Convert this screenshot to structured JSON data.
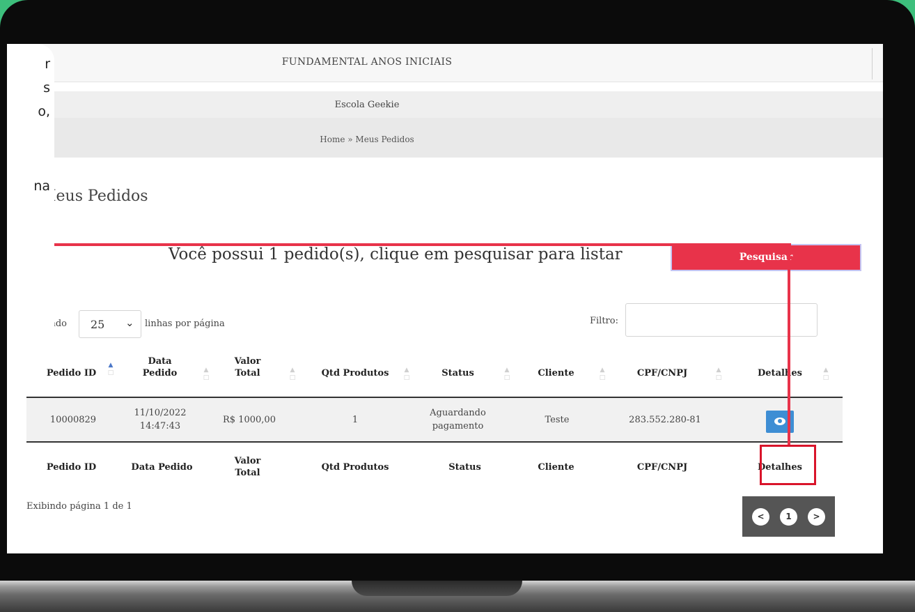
{
  "header": {
    "title": "FUNDAMENTAL ANOS INICIAIS",
    "school": "Escola Geekie",
    "breadcrumb": "Home » Meus Pedidos"
  },
  "sidebar": {
    "fragments": [
      "r",
      "s",
      "o,",
      "na"
    ]
  },
  "page": {
    "heading": "Meus Pedidos",
    "notice": "Você possui 1 pedido(s), clique em pesquisar para listar",
    "search_button": "Pesquisar"
  },
  "table_controls": {
    "show_label": "Exibindo",
    "rows_value": "25",
    "per_page_label": "linhas por página",
    "filter_label": "Filtro:",
    "filter_value": ""
  },
  "table": {
    "headers": [
      {
        "l1": "Pedido ID",
        "l2": ""
      },
      {
        "l1": "Data",
        "l2": "Pedido"
      },
      {
        "l1": "Valor",
        "l2": "Total"
      },
      {
        "l1": "Qtd Produtos",
        "l2": ""
      },
      {
        "l1": "Status",
        "l2": ""
      },
      {
        "l1": "Cliente",
        "l2": ""
      },
      {
        "l1": "CPF/CNPJ",
        "l2": ""
      },
      {
        "l1": "Detalhes",
        "l2": ""
      }
    ],
    "rows": [
      {
        "id": "10000829",
        "date": "11/10/2022",
        "time": "14:47:43",
        "total": "R$ 1000,00",
        "qty": "1",
        "status_l1": "Aguardando",
        "status_l2": "pagamento",
        "client": "Teste",
        "doc": "283.552.280-81"
      }
    ],
    "footer": [
      "Pedido ID",
      "Data Pedido",
      "Valor",
      "Total",
      "Qtd Produtos",
      "Status",
      "Cliente",
      "CPF/CNPJ",
      "Detalhes"
    ]
  },
  "pagination": {
    "info": "Exibindo página 1 de 1",
    "prev": "<",
    "current": "1",
    "next": ">"
  },
  "colors": {
    "accent": "#e8334a",
    "view_button": "#3e8ed4",
    "background": "#3dbf7c"
  }
}
